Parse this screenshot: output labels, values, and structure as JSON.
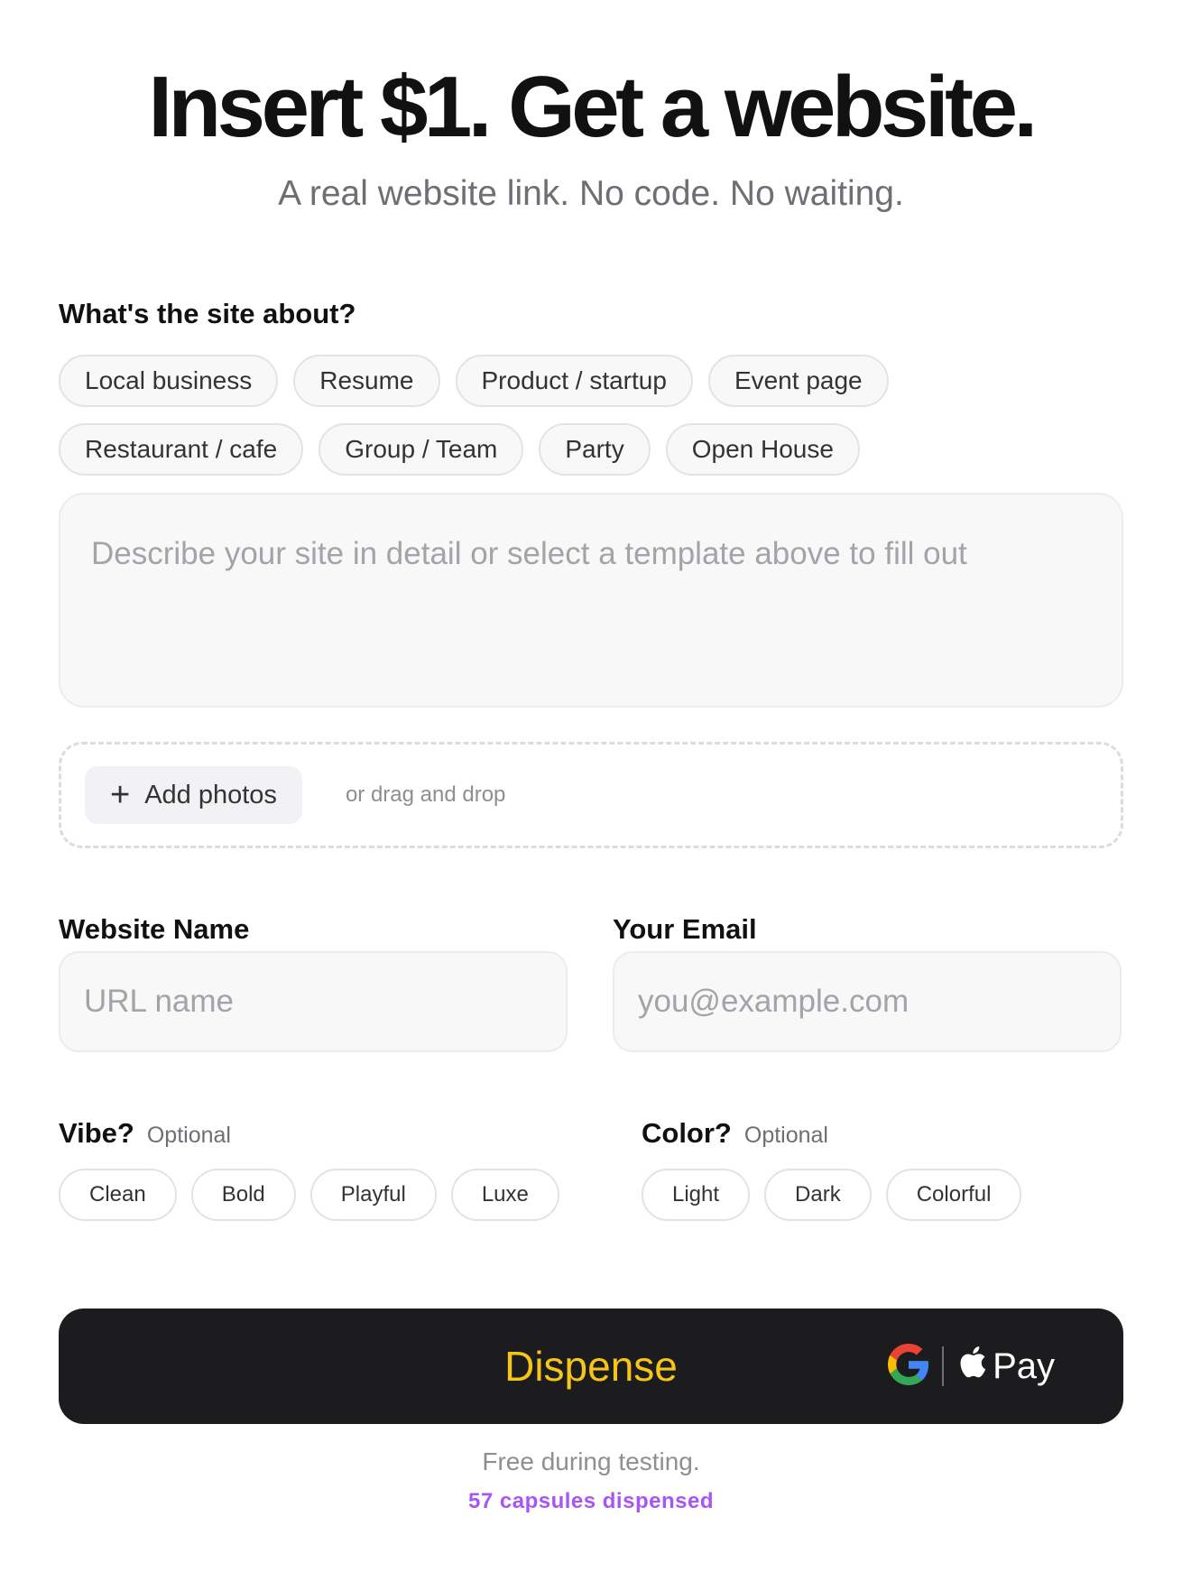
{
  "hero": {
    "title": "Insert $1. Get a website.",
    "subtitle": "A real website link. No code. No waiting."
  },
  "about": {
    "label": "What's the site about?",
    "templates_row1": [
      "Local business",
      "Resume",
      "Product / startup",
      "Event page"
    ],
    "templates_row2": [
      "Restaurant / cafe",
      "Group / Team",
      "Party",
      "Open House"
    ],
    "description_placeholder": "Describe your site in detail or select a template above to fill out"
  },
  "photos": {
    "add_label": "Add photos",
    "hint": "or drag and drop"
  },
  "website_name": {
    "label": "Website Name",
    "placeholder": "URL name"
  },
  "email": {
    "label": "Your Email",
    "placeholder": "you@example.com"
  },
  "vibe": {
    "label": "Vibe?",
    "optional": "Optional",
    "options": [
      "Clean",
      "Bold",
      "Playful",
      "Luxe"
    ]
  },
  "color": {
    "label": "Color?",
    "optional": "Optional",
    "options": [
      "Light",
      "Dark",
      "Colorful"
    ]
  },
  "cta": {
    "label": "Dispense",
    "pay_label": "Pay",
    "accent": "#f5c518"
  },
  "footer": {
    "note": "Free during testing.",
    "count": "57 capsules dispensed",
    "count_color": "#a855f7"
  }
}
